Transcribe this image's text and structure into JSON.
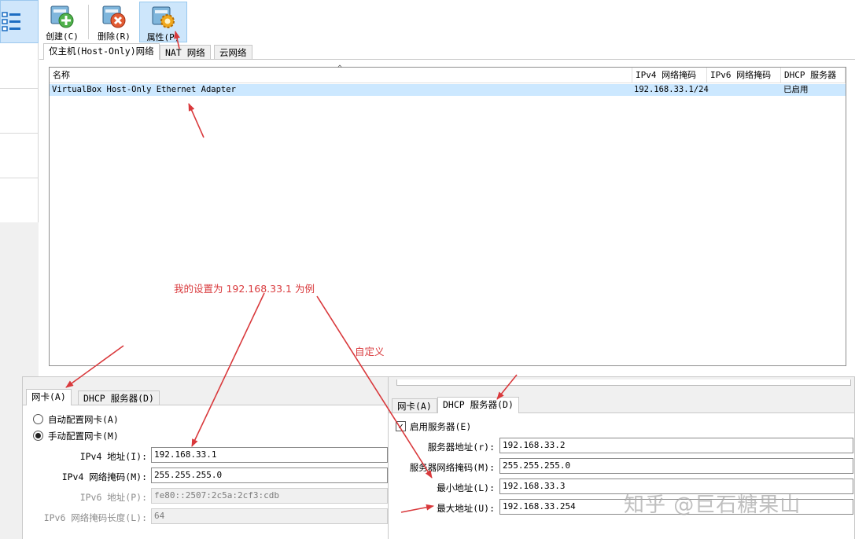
{
  "toolbar": {
    "create_label": "创建(C)",
    "remove_label": "删除(R)",
    "properties_label": "属性(P)"
  },
  "tabs": {
    "host_only": "仅主机(Host-Only)网络",
    "nat": "NAT 网络",
    "cloud": "云网络"
  },
  "network_table": {
    "columns": [
      "名称",
      "IPv4 网络掩码",
      "IPv6 网络掩码",
      "DHCP 服务器"
    ],
    "rows": [
      {
        "name": "VirtualBox Host-Only Ethernet Adapter",
        "ipv4": "192.168.33.1/24",
        "ipv6": "",
        "dhcp": "已启用"
      }
    ]
  },
  "annotations": {
    "example_note": "我的设置为 192.168.33.1 为例",
    "custom_note": "自定义"
  },
  "adapter_dialog": {
    "tab_adapter": "网卡(A)",
    "tab_dhcp": "DHCP 服务器(D)",
    "auto_config": "自动配置网卡(A)",
    "manual_config": "手动配置网卡(M)",
    "ipv4_address_label": "IPv4 地址(I):",
    "ipv4_address": "192.168.33.1",
    "ipv4_mask_label": "IPv4 网络掩码(M):",
    "ipv4_mask": "255.255.255.0",
    "ipv6_address_label": "IPv6 地址(P):",
    "ipv6_address": "fe80::2507:2c5a:2cf3:cdb",
    "ipv6_prefix_label": "IPv6 网络掩码长度(L):",
    "ipv6_prefix": "64"
  },
  "dhcp_dialog": {
    "tab_adapter": "网卡(A)",
    "tab_dhcp": "DHCP 服务器(D)",
    "enable_server": "启用服务器(E)",
    "server_address_label": "服务器地址(r):",
    "server_address": "192.168.33.2",
    "server_mask_label": "服务器网络掩码(M):",
    "server_mask": "255.255.255.0",
    "lower_address_label": "最小地址(L):",
    "lower_address": "192.168.33.3",
    "upper_address_label": "最大地址(U):",
    "upper_address": "192.168.33.254"
  },
  "watermark": "知乎 @巨石糖果山",
  "colors": {
    "annotation_red": "#d9393c",
    "selection_blue": "#cce8ff",
    "active_button": "#cde6fb"
  }
}
